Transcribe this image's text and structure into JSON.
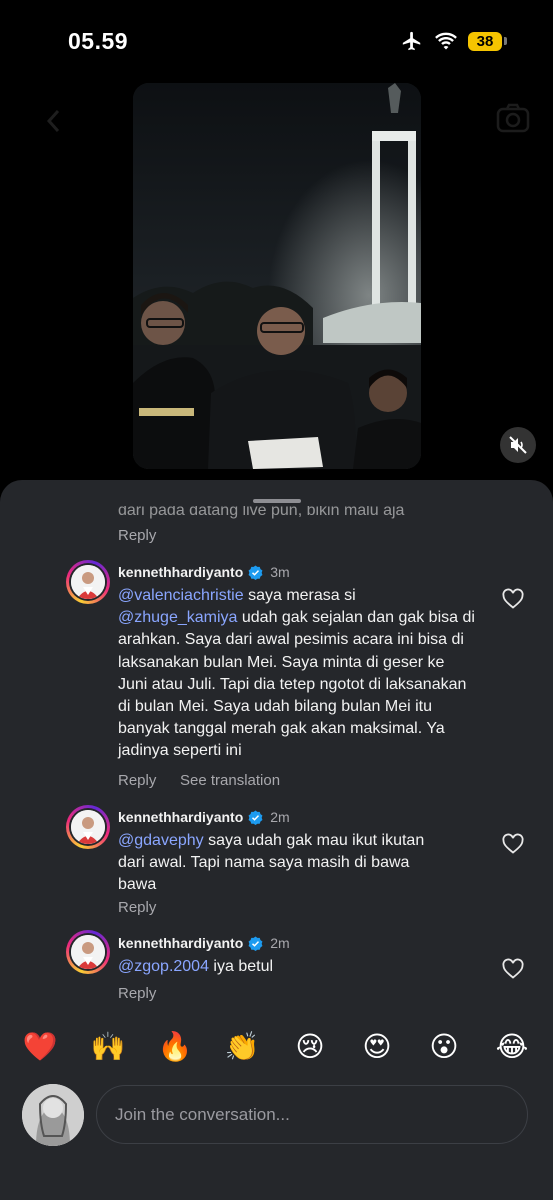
{
  "status_bar": {
    "time": "05.59",
    "battery": "38"
  },
  "comments": {
    "partial_text": "dari pada datang live pun, bikin malu aja",
    "reply_label": "Reply",
    "items": [
      {
        "username": "kennethhardiyanto",
        "time_ago": "3m",
        "mention": "@valenciachristie",
        "line1_rest": " saya merasa si",
        "mention2": "@zhuge_kamiya",
        "line2_rest": " udah gak sejalan dan gak bisa di arahkan. Saya dari awal pesimis acara ini bisa di laksanakan bulan Mei. Saya minta di geser ke Juni atau Juli. Tapi dia tetep ngotot di laksanakan di bulan Mei. Saya udah bilang bulan Mei itu banyak tanggal merah gak akan maksimal. Ya jadinya seperti ini",
        "reply": "Reply",
        "see_translation": "See translation"
      },
      {
        "username": "kennethhardiyanto",
        "time_ago": "2m",
        "mention": "@gdavephy",
        "text": " saya udah gak mau ikut ikutan dari awal. Tapi nama saya masih di bawa bawa",
        "reply": "Reply"
      },
      {
        "username": "kennethhardiyanto",
        "time_ago": "2m",
        "mention": "@zgop.2004",
        "text": " iya betul",
        "reply": "Reply"
      }
    ]
  },
  "emojis": [
    "❤️",
    "🙌",
    "🔥",
    "👏",
    "😢",
    "😍",
    "😮",
    "😂"
  ],
  "composer": {
    "placeholder": "Join the conversation..."
  },
  "colors": {
    "sheet": "#25272b",
    "mention": "#8aa6ff",
    "battery": "#f5c400",
    "verified": "#1d9bf0"
  }
}
